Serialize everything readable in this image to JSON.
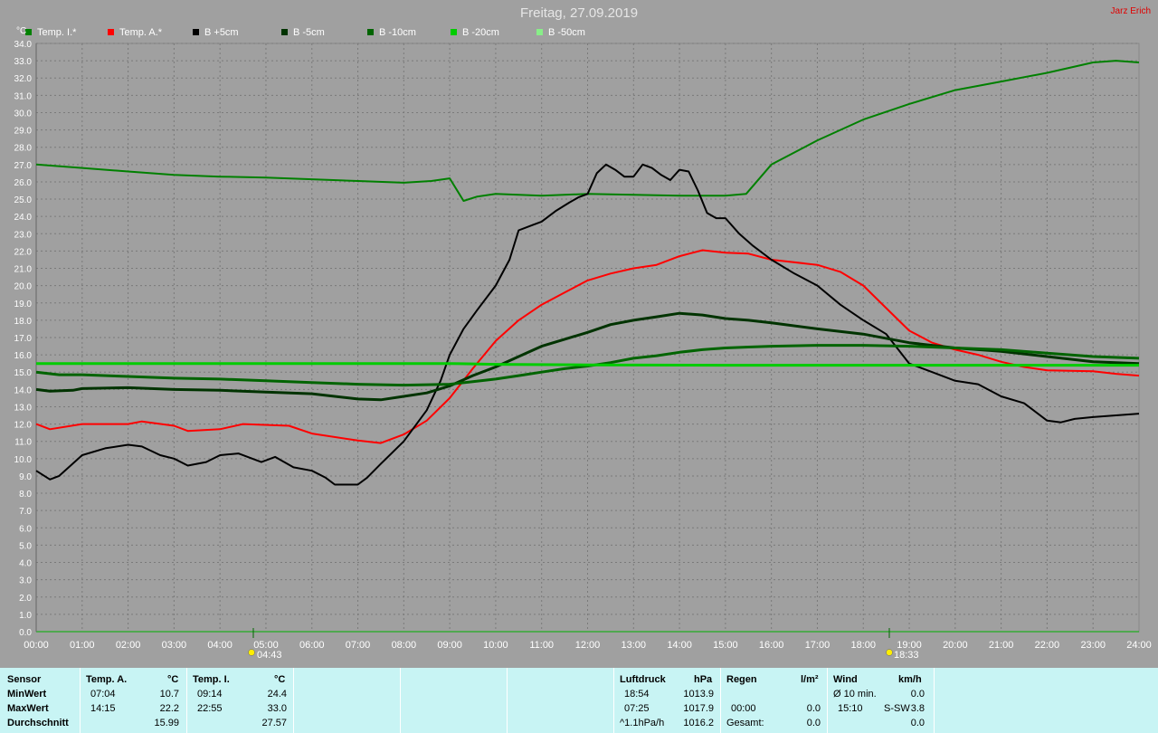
{
  "title": "Freitag, 27.09.2019",
  "author": "Jarz Erich",
  "y_unit": "°C",
  "legend": [
    {
      "label": "Temp. I.*",
      "color": "#008000"
    },
    {
      "label": "Temp. A.*",
      "color": "#ff0000"
    },
    {
      "label": "B +5cm",
      "color": "#000000"
    },
    {
      "label": "B -5cm",
      "color": "#003300"
    },
    {
      "label": "B -10cm",
      "color": "#006400"
    },
    {
      "label": "B -20cm",
      "color": "#00cc00"
    },
    {
      "label": "B -50cm",
      "color": "#88ee88"
    }
  ],
  "markers": {
    "sunrise": "04:43",
    "sunset": "18:33"
  },
  "chart_data": {
    "type": "line",
    "x_unit": "hours",
    "xlim": [
      0,
      24
    ],
    "ylim": [
      0,
      34
    ],
    "grid": true,
    "legend_position": "top-left",
    "x_ticks": [
      "00:00",
      "01:00",
      "02:00",
      "03:00",
      "04:00",
      "05:00",
      "06:00",
      "07:00",
      "08:00",
      "09:00",
      "10:00",
      "11:00",
      "12:00",
      "13:00",
      "14:00",
      "15:00",
      "16:00",
      "17:00",
      "18:00",
      "19:00",
      "20:00",
      "21:00",
      "22:00",
      "23:00",
      "24:00"
    ],
    "y_ticks": [
      "0.0",
      "1.0",
      "2.0",
      "3.0",
      "4.0",
      "5.0",
      "6.0",
      "7.0",
      "8.0",
      "9.0",
      "10.0",
      "11.0",
      "12.0",
      "13.0",
      "14.0",
      "15.0",
      "16.0",
      "17.0",
      "18.0",
      "19.0",
      "20.0",
      "21.0",
      "22.0",
      "23.0",
      "24.0",
      "25.0",
      "26.0",
      "27.0",
      "28.0",
      "29.0",
      "30.0",
      "31.0",
      "32.0",
      "33.0",
      "34.0"
    ],
    "series": [
      {
        "name": "Temp. I.*",
        "color": "#008000",
        "width": 2,
        "points": [
          [
            0,
            27.0
          ],
          [
            1,
            26.8
          ],
          [
            2,
            26.6
          ],
          [
            3,
            26.4
          ],
          [
            4,
            26.3
          ],
          [
            5,
            26.25
          ],
          [
            6,
            26.15
          ],
          [
            7,
            26.05
          ],
          [
            8,
            25.95
          ],
          [
            8.6,
            26.05
          ],
          [
            9.0,
            26.2
          ],
          [
            9.3,
            24.9
          ],
          [
            9.6,
            25.15
          ],
          [
            10,
            25.3
          ],
          [
            11,
            25.2
          ],
          [
            12,
            25.3
          ],
          [
            13,
            25.25
          ],
          [
            14,
            25.2
          ],
          [
            15,
            25.2
          ],
          [
            15.45,
            25.3
          ],
          [
            16,
            27.0
          ],
          [
            17,
            28.4
          ],
          [
            18,
            29.6
          ],
          [
            19,
            30.5
          ],
          [
            20,
            31.3
          ],
          [
            21,
            31.8
          ],
          [
            22,
            32.3
          ],
          [
            23,
            32.9
          ],
          [
            23.5,
            33.0
          ],
          [
            24,
            32.9
          ]
        ]
      },
      {
        "name": "Temp. A.*",
        "color": "#ff0000",
        "width": 2,
        "points": [
          [
            0,
            12.0
          ],
          [
            0.3,
            11.7
          ],
          [
            1,
            12.0
          ],
          [
            2,
            12.0
          ],
          [
            2.3,
            12.15
          ],
          [
            3,
            11.9
          ],
          [
            3.3,
            11.6
          ],
          [
            4,
            11.7
          ],
          [
            4.5,
            12.0
          ],
          [
            5.5,
            11.9
          ],
          [
            6,
            11.45
          ],
          [
            7,
            11.05
          ],
          [
            7.5,
            10.9
          ],
          [
            8,
            11.4
          ],
          [
            8.5,
            12.2
          ],
          [
            9,
            13.5
          ],
          [
            9.5,
            15.2
          ],
          [
            10,
            16.8
          ],
          [
            10.5,
            18.0
          ],
          [
            11,
            18.9
          ],
          [
            11.5,
            19.6
          ],
          [
            12,
            20.3
          ],
          [
            12.5,
            20.7
          ],
          [
            13,
            21.0
          ],
          [
            13.5,
            21.2
          ],
          [
            14,
            21.7
          ],
          [
            14.5,
            22.05
          ],
          [
            15,
            21.9
          ],
          [
            15.5,
            21.85
          ],
          [
            16,
            21.5
          ],
          [
            17,
            21.2
          ],
          [
            17.5,
            20.8
          ],
          [
            18,
            20.0
          ],
          [
            18.5,
            18.7
          ],
          [
            19,
            17.4
          ],
          [
            19.5,
            16.7
          ],
          [
            20,
            16.3
          ],
          [
            20.5,
            16.0
          ],
          [
            21,
            15.6
          ],
          [
            21.5,
            15.3
          ],
          [
            22,
            15.1
          ],
          [
            23,
            15.05
          ],
          [
            23.5,
            14.9
          ],
          [
            24,
            14.8
          ]
        ]
      },
      {
        "name": "B +5cm",
        "color": "#000000",
        "width": 2,
        "points": [
          [
            0,
            9.3
          ],
          [
            0.3,
            8.8
          ],
          [
            0.5,
            9.0
          ],
          [
            1,
            10.2
          ],
          [
            1.5,
            10.6
          ],
          [
            2,
            10.8
          ],
          [
            2.3,
            10.7
          ],
          [
            2.7,
            10.2
          ],
          [
            3,
            10.0
          ],
          [
            3.3,
            9.6
          ],
          [
            3.7,
            9.8
          ],
          [
            4,
            10.2
          ],
          [
            4.4,
            10.3
          ],
          [
            4.9,
            9.8
          ],
          [
            5.2,
            10.1
          ],
          [
            5.6,
            9.5
          ],
          [
            6,
            9.3
          ],
          [
            6.3,
            8.9
          ],
          [
            6.5,
            8.5
          ],
          [
            7,
            8.5
          ],
          [
            7.2,
            8.9
          ],
          [
            7.5,
            9.7
          ],
          [
            8,
            11.0
          ],
          [
            8.5,
            12.8
          ],
          [
            8.8,
            14.5
          ],
          [
            9.0,
            16.0
          ],
          [
            9.3,
            17.5
          ],
          [
            9.6,
            18.6
          ],
          [
            10,
            20.0
          ],
          [
            10.3,
            21.5
          ],
          [
            10.5,
            23.2
          ],
          [
            10.8,
            23.5
          ],
          [
            11,
            23.7
          ],
          [
            11.3,
            24.3
          ],
          [
            11.6,
            24.8
          ],
          [
            11.8,
            25.1
          ],
          [
            12,
            25.3
          ],
          [
            12.2,
            26.5
          ],
          [
            12.4,
            27.0
          ],
          [
            12.6,
            26.7
          ],
          [
            12.8,
            26.3
          ],
          [
            13,
            26.3
          ],
          [
            13.2,
            27.0
          ],
          [
            13.4,
            26.8
          ],
          [
            13.6,
            26.4
          ],
          [
            13.8,
            26.1
          ],
          [
            14,
            26.7
          ],
          [
            14.2,
            26.6
          ],
          [
            14.4,
            25.5
          ],
          [
            14.6,
            24.2
          ],
          [
            14.8,
            23.9
          ],
          [
            15,
            23.9
          ],
          [
            15.3,
            23.0
          ],
          [
            15.6,
            22.3
          ],
          [
            16,
            21.5
          ],
          [
            16.5,
            20.7
          ],
          [
            17,
            20.0
          ],
          [
            17.5,
            18.9
          ],
          [
            18,
            18.0
          ],
          [
            18.5,
            17.2
          ],
          [
            19,
            15.5
          ],
          [
            19.5,
            15.0
          ],
          [
            20,
            14.5
          ],
          [
            20.5,
            14.3
          ],
          [
            21,
            13.6
          ],
          [
            21.5,
            13.2
          ],
          [
            22,
            12.2
          ],
          [
            22.3,
            12.1
          ],
          [
            22.6,
            12.3
          ],
          [
            23,
            12.4
          ],
          [
            23.5,
            12.5
          ],
          [
            24,
            12.6
          ]
        ]
      },
      {
        "name": "B -5cm",
        "color": "#003300",
        "width": 3,
        "points": [
          [
            0,
            14.0
          ],
          [
            0.3,
            13.9
          ],
          [
            0.8,
            13.95
          ],
          [
            1,
            14.05
          ],
          [
            2,
            14.1
          ],
          [
            3,
            14.0
          ],
          [
            4,
            13.95
          ],
          [
            5,
            13.85
          ],
          [
            6,
            13.75
          ],
          [
            7,
            13.45
          ],
          [
            7.5,
            13.4
          ],
          [
            8,
            13.6
          ],
          [
            8.5,
            13.8
          ],
          [
            9,
            14.2
          ],
          [
            9.5,
            14.8
          ],
          [
            10,
            15.3
          ],
          [
            10.5,
            15.9
          ],
          [
            11,
            16.5
          ],
          [
            11.5,
            16.9
          ],
          [
            12,
            17.3
          ],
          [
            12.5,
            17.75
          ],
          [
            13,
            18.0
          ],
          [
            13.5,
            18.2
          ],
          [
            14,
            18.4
          ],
          [
            14.5,
            18.3
          ],
          [
            15,
            18.1
          ],
          [
            15.5,
            18.0
          ],
          [
            16,
            17.85
          ],
          [
            17,
            17.5
          ],
          [
            18,
            17.2
          ],
          [
            19,
            16.7
          ],
          [
            20,
            16.4
          ],
          [
            20.5,
            16.3
          ],
          [
            21,
            16.2
          ],
          [
            22,
            15.9
          ],
          [
            23,
            15.6
          ],
          [
            24,
            15.5
          ]
        ]
      },
      {
        "name": "B -10cm",
        "color": "#006400",
        "width": 3,
        "points": [
          [
            0,
            15.0
          ],
          [
            0.5,
            14.85
          ],
          [
            1,
            14.85
          ],
          [
            2,
            14.75
          ],
          [
            3,
            14.65
          ],
          [
            4,
            14.6
          ],
          [
            5,
            14.5
          ],
          [
            6,
            14.4
          ],
          [
            7,
            14.3
          ],
          [
            8,
            14.25
          ],
          [
            9,
            14.3
          ],
          [
            9.5,
            14.45
          ],
          [
            10,
            14.6
          ],
          [
            10.5,
            14.8
          ],
          [
            11,
            15.0
          ],
          [
            11.5,
            15.2
          ],
          [
            12,
            15.35
          ],
          [
            12.5,
            15.55
          ],
          [
            13,
            15.8
          ],
          [
            13.5,
            15.95
          ],
          [
            14,
            16.15
          ],
          [
            14.5,
            16.3
          ],
          [
            15,
            16.4
          ],
          [
            15.5,
            16.45
          ],
          [
            16,
            16.5
          ],
          [
            17,
            16.55
          ],
          [
            18,
            16.55
          ],
          [
            19,
            16.5
          ],
          [
            20,
            16.4
          ],
          [
            21,
            16.3
          ],
          [
            22,
            16.1
          ],
          [
            23,
            15.9
          ],
          [
            24,
            15.8
          ]
        ]
      },
      {
        "name": "B -20cm",
        "color": "#00cc00",
        "width": 3,
        "points": [
          [
            0,
            15.5
          ],
          [
            5,
            15.5
          ],
          [
            9,
            15.5
          ],
          [
            9.5,
            15.48
          ],
          [
            10,
            15.45
          ],
          [
            12,
            15.42
          ],
          [
            15,
            15.4
          ],
          [
            18,
            15.4
          ],
          [
            21,
            15.4
          ],
          [
            24,
            15.4
          ]
        ]
      }
    ]
  },
  "stats": {
    "sensor_header": "Sensor",
    "row_labels": [
      "MinWert",
      "MaxWert",
      "Durchschnitt"
    ],
    "temp_a": {
      "header": "Temp. A.",
      "unit": "°C",
      "min_time": "07:04",
      "min": "10.7",
      "max_time": "14:15",
      "max": "22.2",
      "avg": "15.99"
    },
    "temp_i": {
      "header": "Temp. I.",
      "unit": "°C",
      "min_time": "09:14",
      "min": "24.4",
      "max_time": "22:55",
      "max": "33.0",
      "avg": "27.57"
    },
    "pressure": {
      "header": "Luftdruck",
      "unit": "hPa",
      "r1_time": "18:54",
      "r1": "1013.9",
      "r2_time": "07:25",
      "r2": "1017.9",
      "r3_label": "^1.1hPa/h",
      "r3": "1016.2"
    },
    "rain": {
      "header": "Regen",
      "unit": "l/m²",
      "r2_time": "00:00",
      "r2": "0.0",
      "r3_label": "Gesamt:",
      "r3": "0.0"
    },
    "wind": {
      "header": "Wind",
      "unit": "km/h",
      "r1_label": "Ø 10 min.",
      "r1": "0.0",
      "r2_time": "15:10",
      "r2_dir": "S-SW",
      "r2": "3.8",
      "r3": "0.0"
    }
  }
}
